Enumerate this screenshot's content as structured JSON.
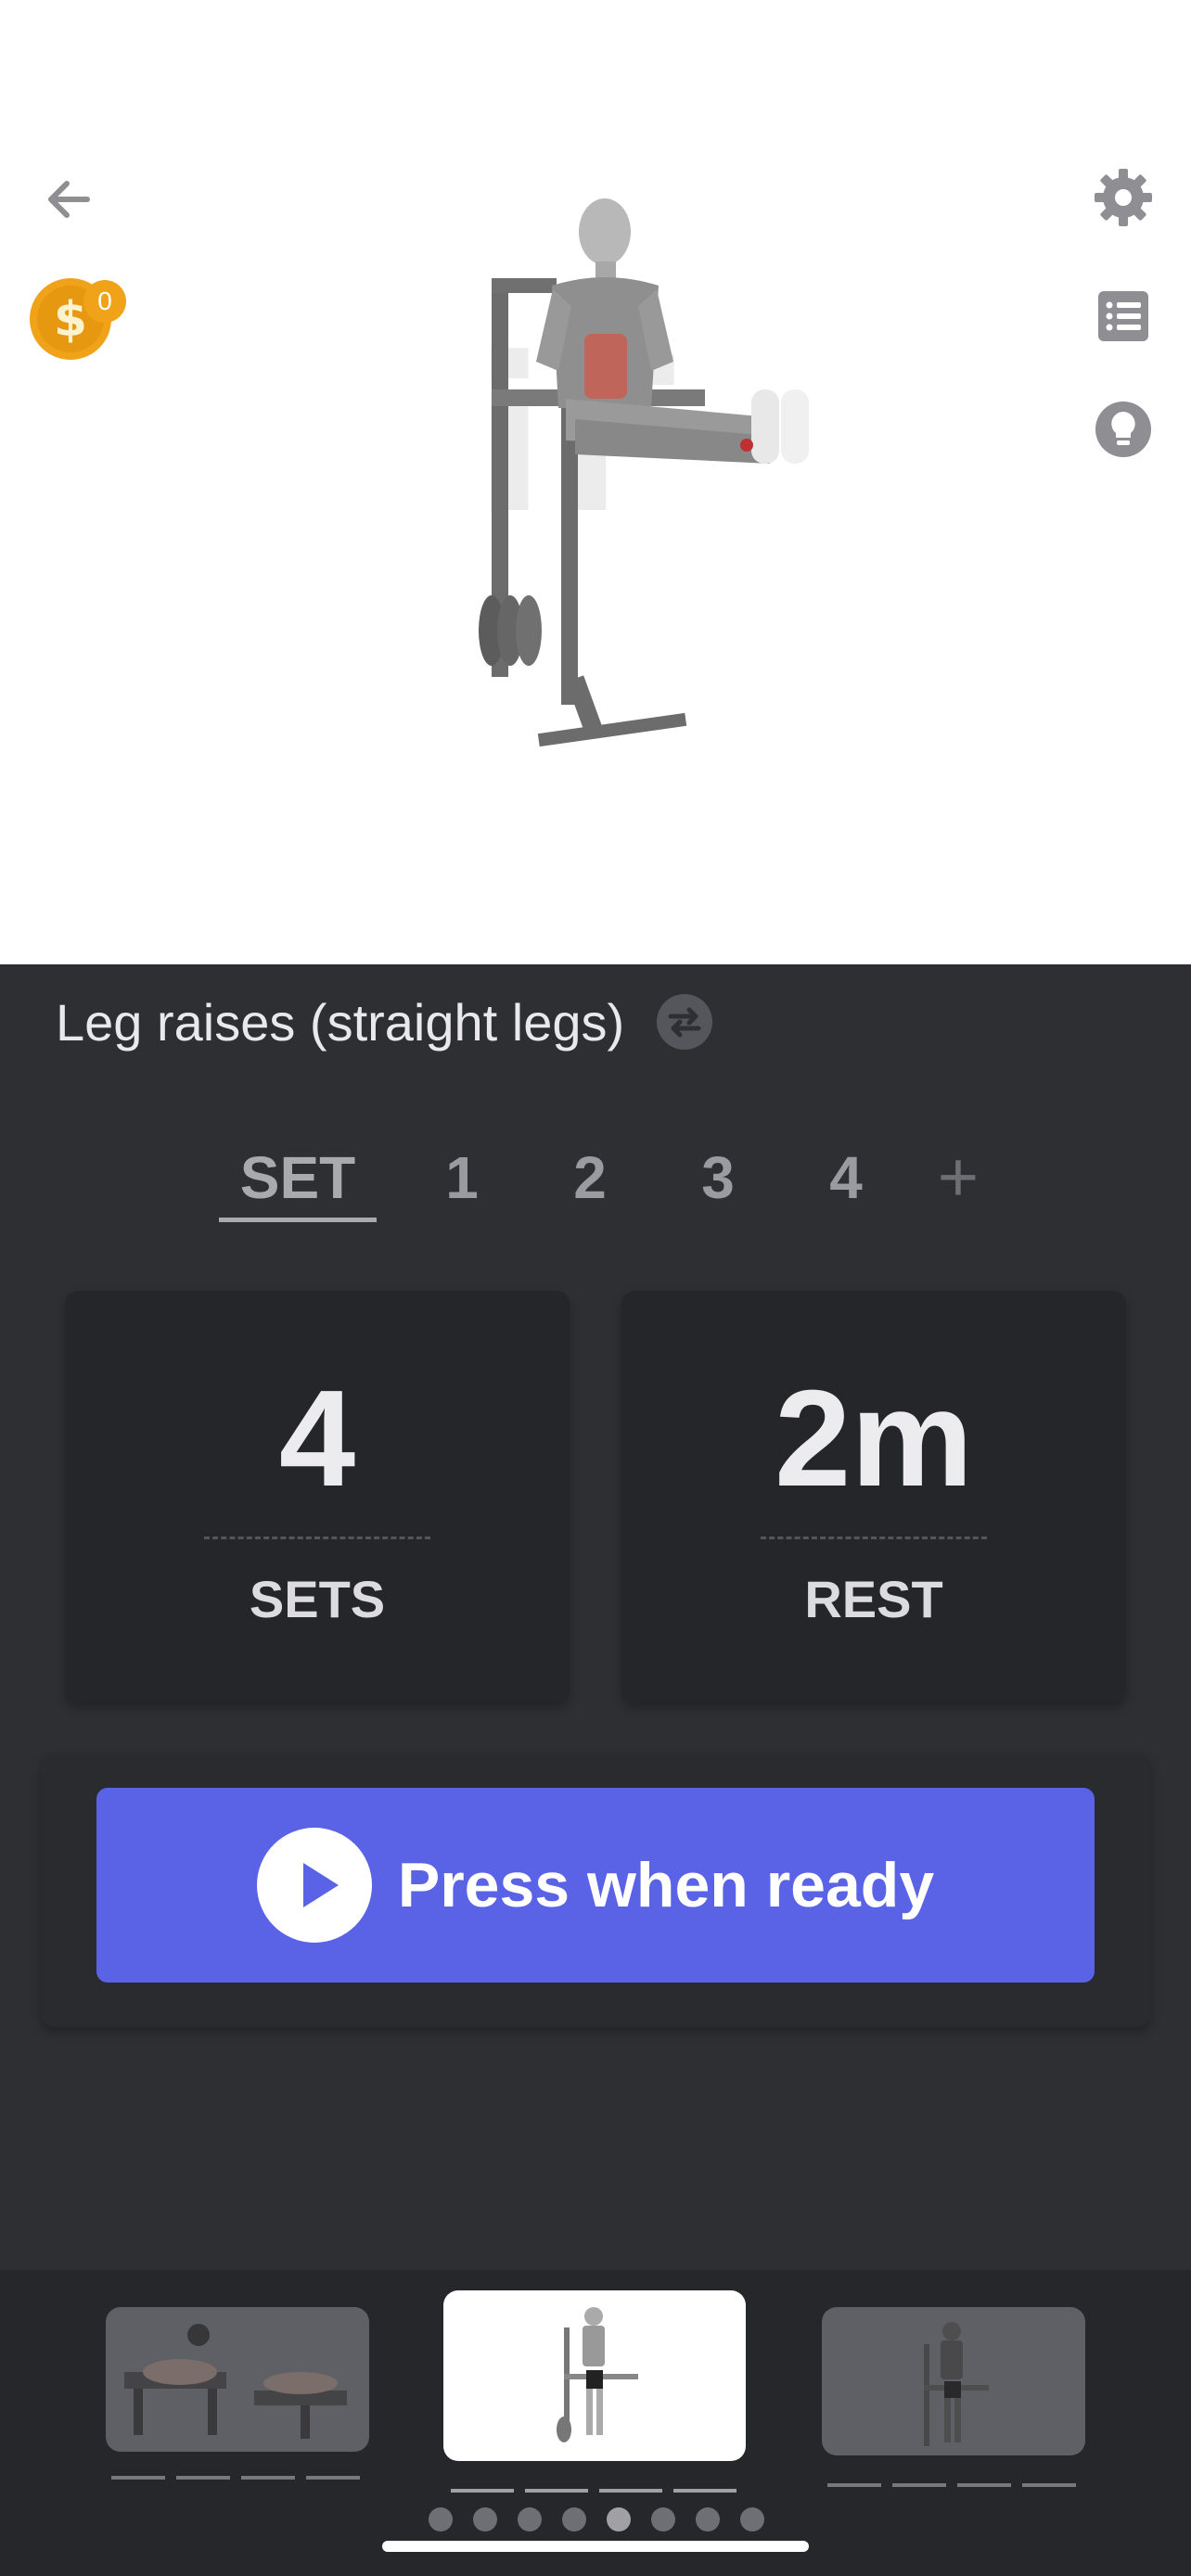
{
  "app": {
    "coin_count": "0"
  },
  "header": {
    "icons": [
      "back-arrow-icon",
      "coin-icon",
      "settings-gear-icon",
      "list-icon",
      "tip-lightbulb-icon"
    ]
  },
  "exercise": {
    "title": "Leg raises (straight legs)",
    "swap_icon": "swap-icon"
  },
  "set_tabs": {
    "items": [
      {
        "label": "SET",
        "active": true
      },
      {
        "label": "1",
        "active": false
      },
      {
        "label": "2",
        "active": false
      },
      {
        "label": "3",
        "active": false
      },
      {
        "label": "4",
        "active": false
      },
      {
        "label": "+",
        "active": false
      }
    ]
  },
  "stats": {
    "sets": {
      "value": "4",
      "label": "SETS"
    },
    "rest": {
      "value": "2m",
      "label": "REST"
    }
  },
  "action": {
    "label": "Press when ready",
    "icon": "play-icon"
  },
  "carousel": {
    "page_count": 8,
    "active_page": 5
  },
  "colors": {
    "accent": "#5a63e6",
    "coin": "#f0a318",
    "background": "#2e2f33"
  }
}
